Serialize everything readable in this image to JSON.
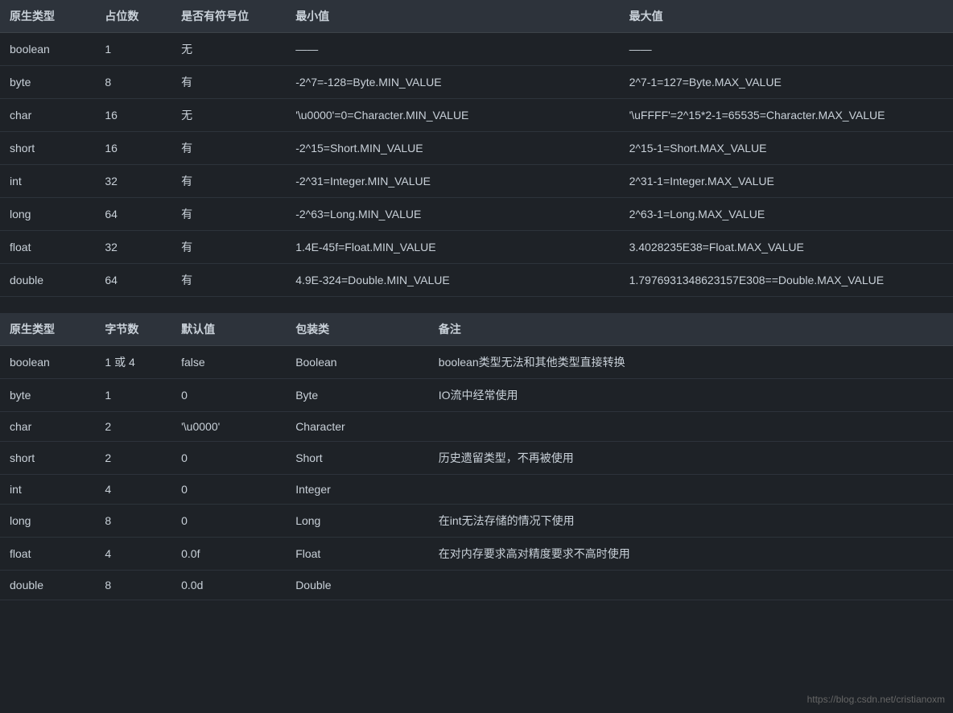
{
  "table1": {
    "headers": [
      "原生类型",
      "占位数",
      "是否有符号位",
      "最小值",
      "最大值"
    ],
    "rows": [
      [
        "boolean",
        "1",
        "无",
        "——",
        "——"
      ],
      [
        "byte",
        "8",
        "有",
        "-2^7=-128=Byte.MIN_VALUE",
        "2^7-1=127=Byte.MAX_VALUE"
      ],
      [
        "char",
        "16",
        "无",
        "'\\u0000'=0=Character.MIN_VALUE",
        "'\\uFFFF'=2^15*2-1=65535=Character.MAX_VALUE"
      ],
      [
        "short",
        "16",
        "有",
        "-2^15=Short.MIN_VALUE",
        "2^15-1=Short.MAX_VALUE"
      ],
      [
        "int",
        "32",
        "有",
        "-2^31=Integer.MIN_VALUE",
        "2^31-1=Integer.MAX_VALUE"
      ],
      [
        "long",
        "64",
        "有",
        "-2^63=Long.MIN_VALUE",
        "2^63-1=Long.MAX_VALUE"
      ],
      [
        "float",
        "32",
        "有",
        "1.4E-45f=Float.MIN_VALUE",
        "3.4028235E38=Float.MAX_VALUE"
      ],
      [
        "double",
        "64",
        "有",
        "4.9E-324=Double.MIN_VALUE",
        "1.7976931348623157E308==Double.MAX_VALUE"
      ]
    ]
  },
  "table2": {
    "headers": [
      "原生类型",
      "字节数",
      "默认值",
      "包装类",
      "备注"
    ],
    "rows": [
      [
        "boolean",
        "1 或 4",
        "false",
        "Boolean",
        "boolean类型无法和其他类型直接转换"
      ],
      [
        "byte",
        "1",
        "0",
        "Byte",
        "IO流中经常使用"
      ],
      [
        "char",
        "2",
        "'\\u0000'",
        "Character",
        ""
      ],
      [
        "short",
        "2",
        "0",
        "Short",
        "历史遗留类型，不再被使用"
      ],
      [
        "int",
        "4",
        "0",
        "Integer",
        ""
      ],
      [
        "long",
        "8",
        "0",
        "Long",
        "在int无法存储的情况下使用"
      ],
      [
        "float",
        "4",
        "0.0f",
        "Float",
        "在对内存要求高对精度要求不高时使用"
      ],
      [
        "double",
        "8",
        "0.0d",
        "Double",
        ""
      ]
    ]
  },
  "watermark": "https://blog.csdn.net/cristianoxm"
}
